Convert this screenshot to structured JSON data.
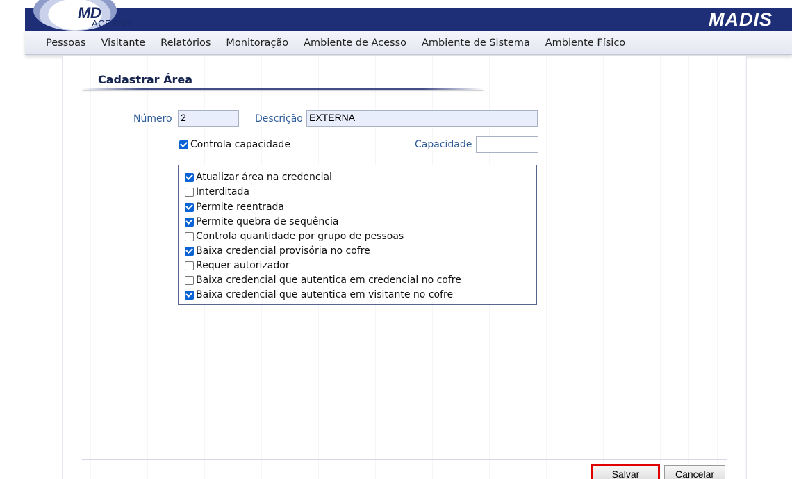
{
  "header": {
    "logo_text": "MD",
    "logo_subtext": "ACESSO",
    "brand": "MADIS",
    "colors": {
      "header_bg": "#1e2f78",
      "label": "#2e5c99",
      "title": "#15234e",
      "checkbox": "#0a63d6",
      "save_highlight": "#e00000"
    }
  },
  "menu": [
    "Pessoas",
    "Visitante",
    "Relatórios",
    "Monitoração",
    "Ambiente de Acesso",
    "Ambiente de Sistema",
    "Ambiente Físico"
  ],
  "page": {
    "title": "Cadastrar Área"
  },
  "form": {
    "numero_label": "Número",
    "numero_value": "2",
    "descricao_label": "Descrição",
    "descricao_value": "EXTERNA",
    "controla_capacidade": {
      "label": "Controla capacidade",
      "checked": true
    },
    "capacidade_label": "Capacidade",
    "capacidade_value": ""
  },
  "options": [
    {
      "label": "Atualizar área na credencial",
      "checked": true
    },
    {
      "label": "Interditada",
      "checked": false
    },
    {
      "label": "Permite reentrada",
      "checked": true
    },
    {
      "label": "Permite quebra de sequência",
      "checked": true
    },
    {
      "label": "Controla quantidade por grupo de pessoas",
      "checked": false
    },
    {
      "label": "Baixa credencial provisória no cofre",
      "checked": true
    },
    {
      "label": "Requer autorizador",
      "checked": false
    },
    {
      "label": "Baixa credencial que autentica em credencial no cofre",
      "checked": false
    },
    {
      "label": "Baixa credencial que autentica em visitante no cofre",
      "checked": true
    }
  ],
  "actions": {
    "save_label": "Salvar",
    "cancel_label": "Cancelar"
  }
}
